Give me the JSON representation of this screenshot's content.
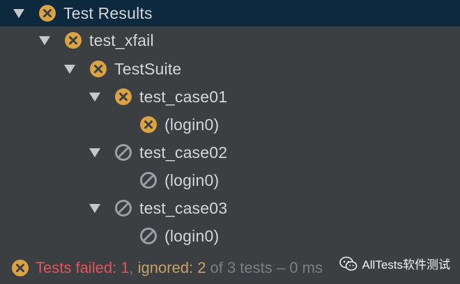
{
  "tree": {
    "nodes": [
      {
        "label": "Test Results",
        "status": "failed",
        "icon": "failed-x-icon",
        "depth": 0,
        "expanded": true,
        "selected": true
      },
      {
        "label": "test_xfail",
        "status": "failed",
        "icon": "failed-x-icon",
        "depth": 1,
        "expanded": true
      },
      {
        "label": "TestSuite",
        "status": "failed",
        "icon": "failed-x-icon",
        "depth": 2,
        "expanded": true
      },
      {
        "label": "test_case01",
        "status": "failed",
        "icon": "failed-x-icon",
        "depth": 3,
        "expanded": true
      },
      {
        "label": "(login0)",
        "status": "failed",
        "icon": "failed-x-icon",
        "depth": 4
      },
      {
        "label": "test_case02",
        "status": "ignored",
        "icon": "ignored-slash-icon",
        "depth": 3,
        "expanded": true
      },
      {
        "label": "(login0)",
        "status": "ignored",
        "icon": "ignored-slash-icon",
        "depth": 4
      },
      {
        "label": "test_case03",
        "status": "ignored",
        "icon": "ignored-slash-icon",
        "depth": 3,
        "expanded": true
      },
      {
        "label": "(login0)",
        "status": "ignored",
        "icon": "ignored-slash-icon",
        "depth": 4
      }
    ]
  },
  "status_bar": {
    "icon": "failed-x-icon",
    "failed_text": "Tests failed: 1",
    "separator": ",",
    "ignored_text": "ignored: 2",
    "rest_text": "of 3 tests – 0 ms"
  },
  "watermark": {
    "icon": "wechat-logo-icon",
    "text": "AllTests软件测试"
  },
  "colors": {
    "background": "#3c3f41",
    "selected_row": "#0d293e",
    "failed": "#e5545c",
    "failed_icon": "#d9a343",
    "ignored": "#c7a067",
    "ignored_icon": "#9ca0a4",
    "text": "#d4d6d8"
  }
}
